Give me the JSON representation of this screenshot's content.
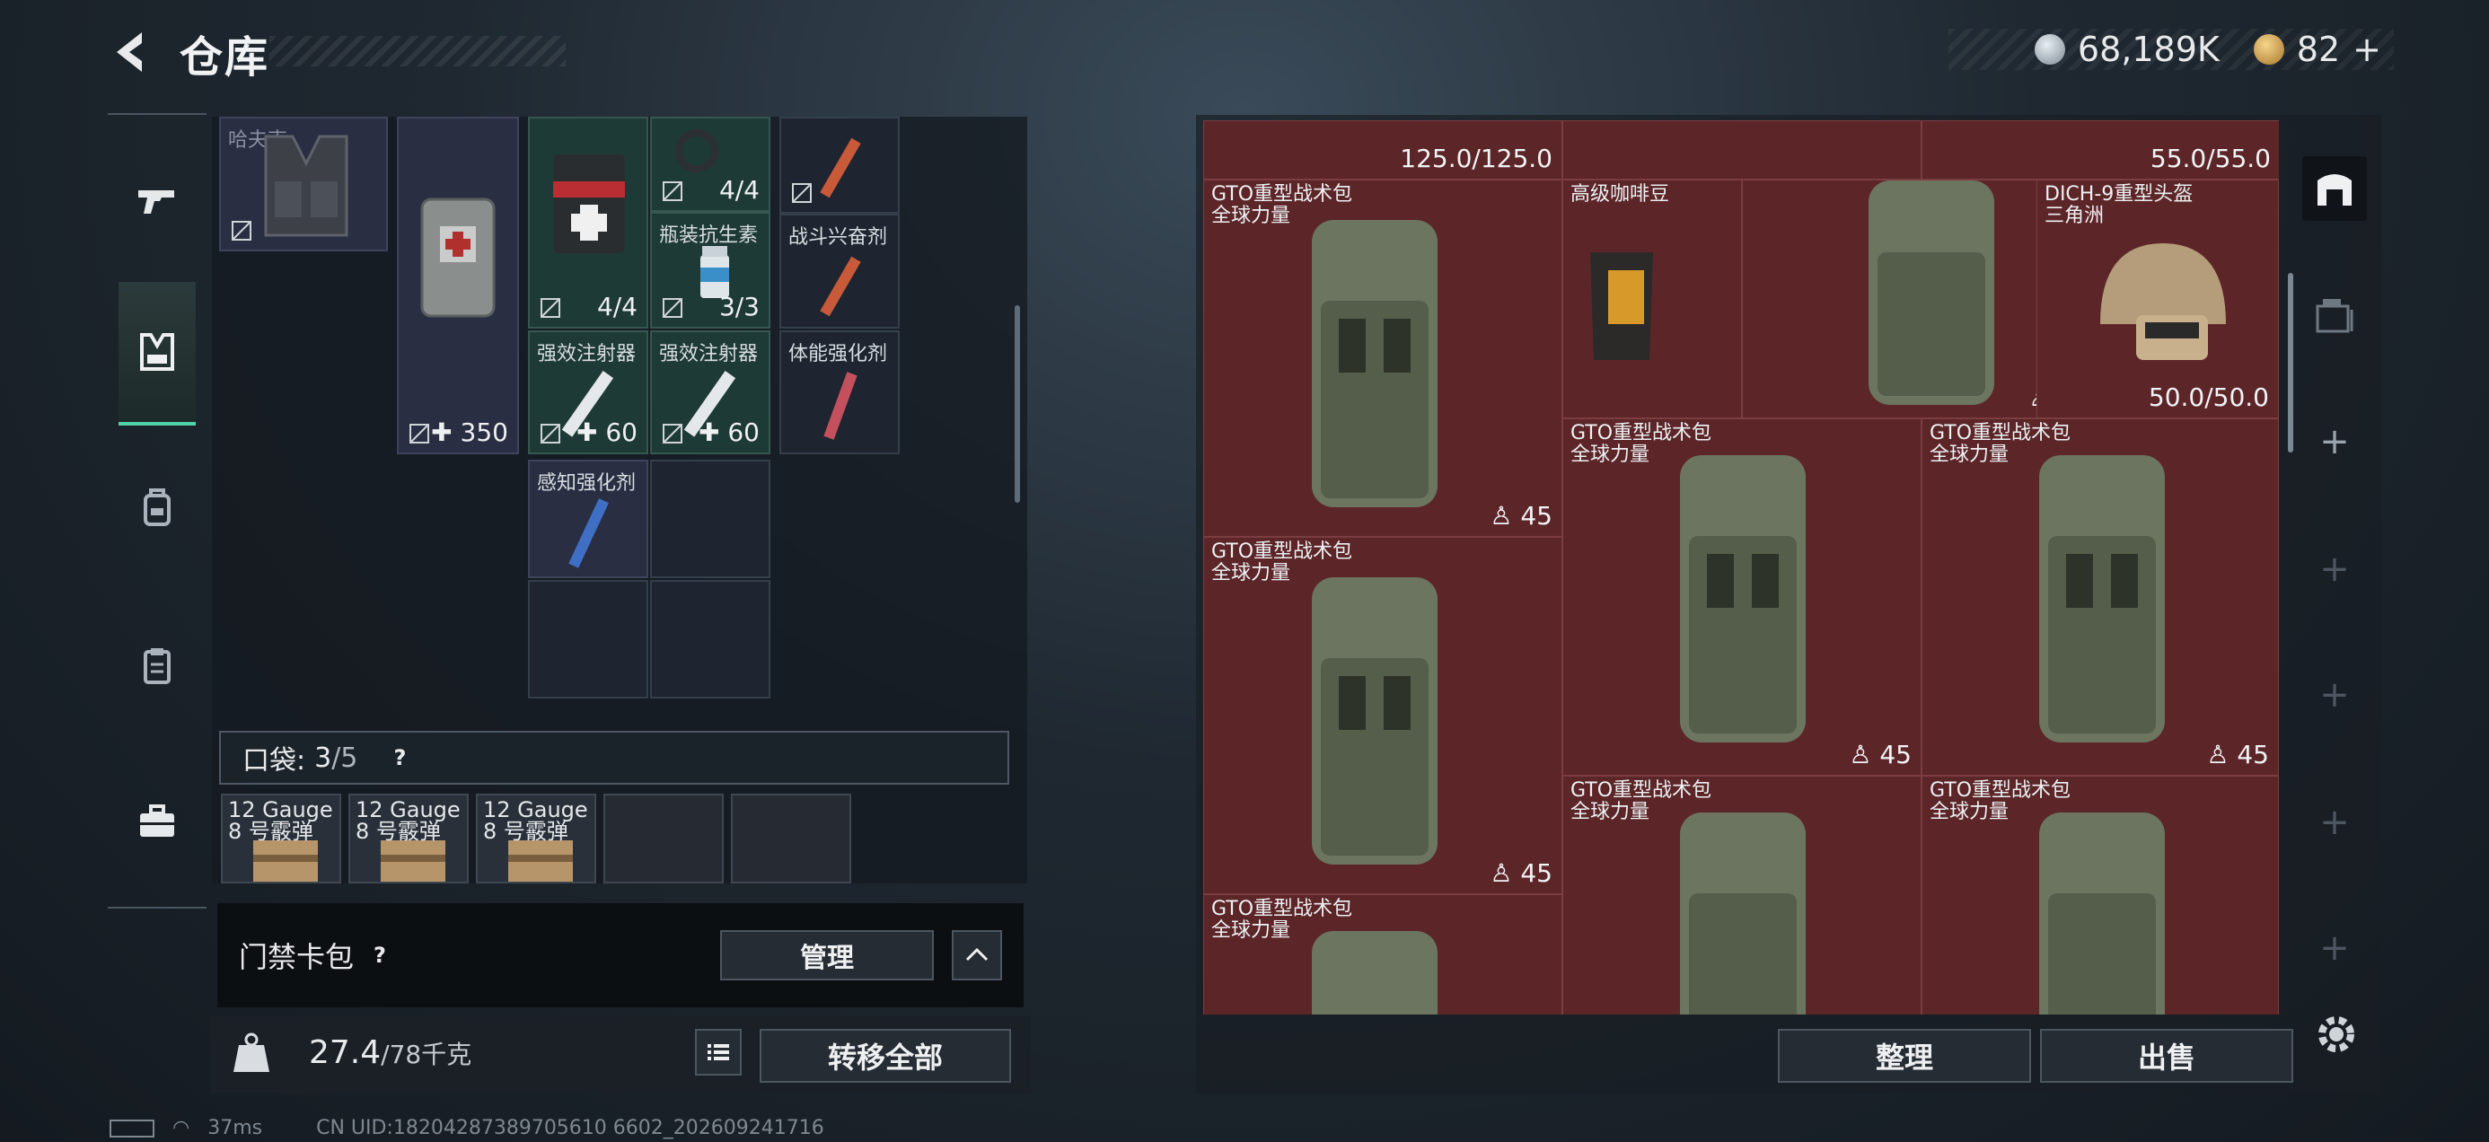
{
  "header": {
    "title": "仓库",
    "currency_silver": "68,189K",
    "currency_gold": "82",
    "gold_add": "+"
  },
  "inventory": {
    "cells": {
      "first_label": "哈夫克",
      "medkit_count": "350",
      "bandage_count": "4/4",
      "tourniquet_count": "4/4",
      "antibiotic_label": "瓶装抗生素",
      "antibiotic_count": "3/3",
      "stim_combat_label": "战斗兴奋剂",
      "injector1_label": "强效注射器",
      "injector1_count": "60",
      "injector2_label": "强效注射器",
      "injector2_count": "60",
      "stim_physical_label": "体能强化剂",
      "stim_perception_label": "感知强化剂"
    },
    "pocket": {
      "label": "口袋:",
      "used": "3",
      "capacity": "/5",
      "help": "?",
      "slots": [
        {
          "label": "12 Gauge\n8 号霰弹"
        },
        {
          "label": "12 Gauge\n8 号霰弹"
        },
        {
          "label": "12 Gauge\n8 号霰弹"
        }
      ]
    },
    "keycard": {
      "label": "门禁卡包",
      "help": "?",
      "manage": "管理"
    },
    "weight": {
      "current": "27.4",
      "max": "/78千克"
    },
    "transfer_all": "转移全部"
  },
  "stash": {
    "top_left_val": "125.0/125.0",
    "top_right_val": "55.0/55.0",
    "items": [
      {
        "name": "GTO重型战术包\n全球力量",
        "val": "45"
      },
      {
        "name": "高级咖啡豆",
        "val": ""
      },
      {
        "name": "",
        "val": "45"
      },
      {
        "name": "DICH-9重型头盔\n三角洲",
        "val": "50.0/50.0"
      },
      {
        "name": "GTO重型战术包\n全球力量",
        "val": "45"
      },
      {
        "name": "GTO重型战术包\n全球力量",
        "val": "45"
      },
      {
        "name": "GTO重型战术包\n全球力量",
        "val": "45"
      },
      {
        "name": "GTO重型战术包\n全球力量",
        "val": ""
      },
      {
        "name": "GTO重型战术包\n全球力量",
        "val": ""
      },
      {
        "name": "GTO重型战术包\n全球力量",
        "val": ""
      }
    ],
    "sort": "整理",
    "sell": "出售"
  },
  "status": {
    "ping": "37ms",
    "uid": "CN UID:18204287389705610 6602_202609241716"
  },
  "colors": {
    "accent": "#4fd2a8",
    "stash_bg": "#5a2528"
  }
}
